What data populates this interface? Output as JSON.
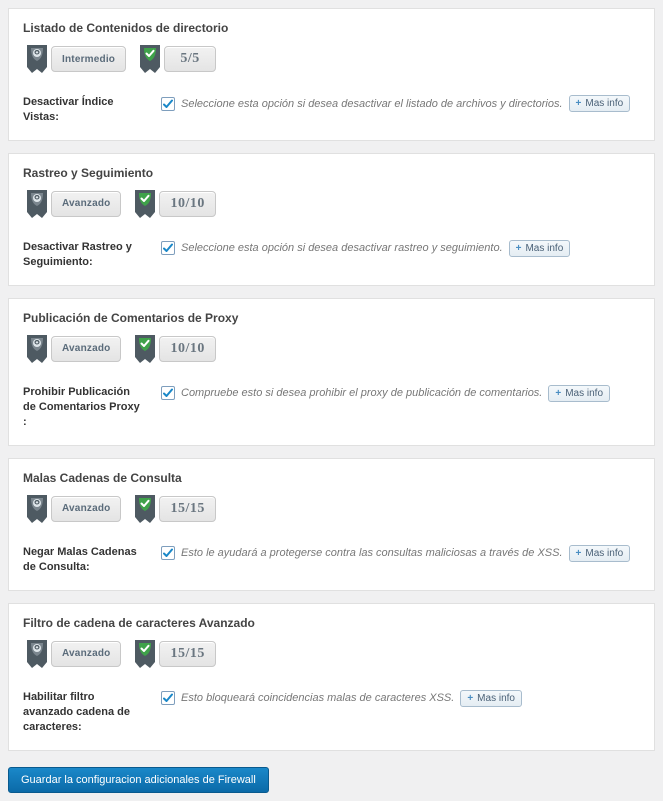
{
  "more_info": "Mas info",
  "save_label": "Guardar la configuracion adicionales de Firewall",
  "sections": [
    {
      "title": "Listado de Contenidos de directorio",
      "level": "Intermedio",
      "score": "5/5",
      "setting_label": "Desactivar Índice Vistas:",
      "checked": true,
      "desc": "Seleccione esta opción si desea desactivar el listado de archivos y directorios."
    },
    {
      "title": "Rastreo y Seguimiento",
      "level": "Avanzado",
      "score": "10/10",
      "setting_label": "Desactivar Rastreo y Seguimiento:",
      "checked": true,
      "desc": "Seleccione esta opción si desea desactivar rastreo y seguimiento."
    },
    {
      "title": "Publicación de Comentarios de Proxy",
      "level": "Avanzado",
      "score": "10/10",
      "setting_label": "Prohibir Publicación de Comentarios Proxy :",
      "checked": true,
      "desc": "Compruebe esto si desea prohibir el proxy de publicación de comentarios."
    },
    {
      "title": "Malas Cadenas de Consulta",
      "level": "Avanzado",
      "score": "15/15",
      "setting_label": "Negar Malas Cadenas de Consulta:",
      "checked": true,
      "desc": "Esto le ayudará a protegerse contra las consultas maliciosas a través de XSS."
    },
    {
      "title": "Filtro de cadena de caracteres Avanzado",
      "level": "Avanzado",
      "score": "15/15",
      "setting_label": "Habilitar filtro avanzado cadena de caracteres:",
      "checked": true,
      "desc": "Esto bloqueará coincidencias malas de caracteres XSS."
    }
  ]
}
